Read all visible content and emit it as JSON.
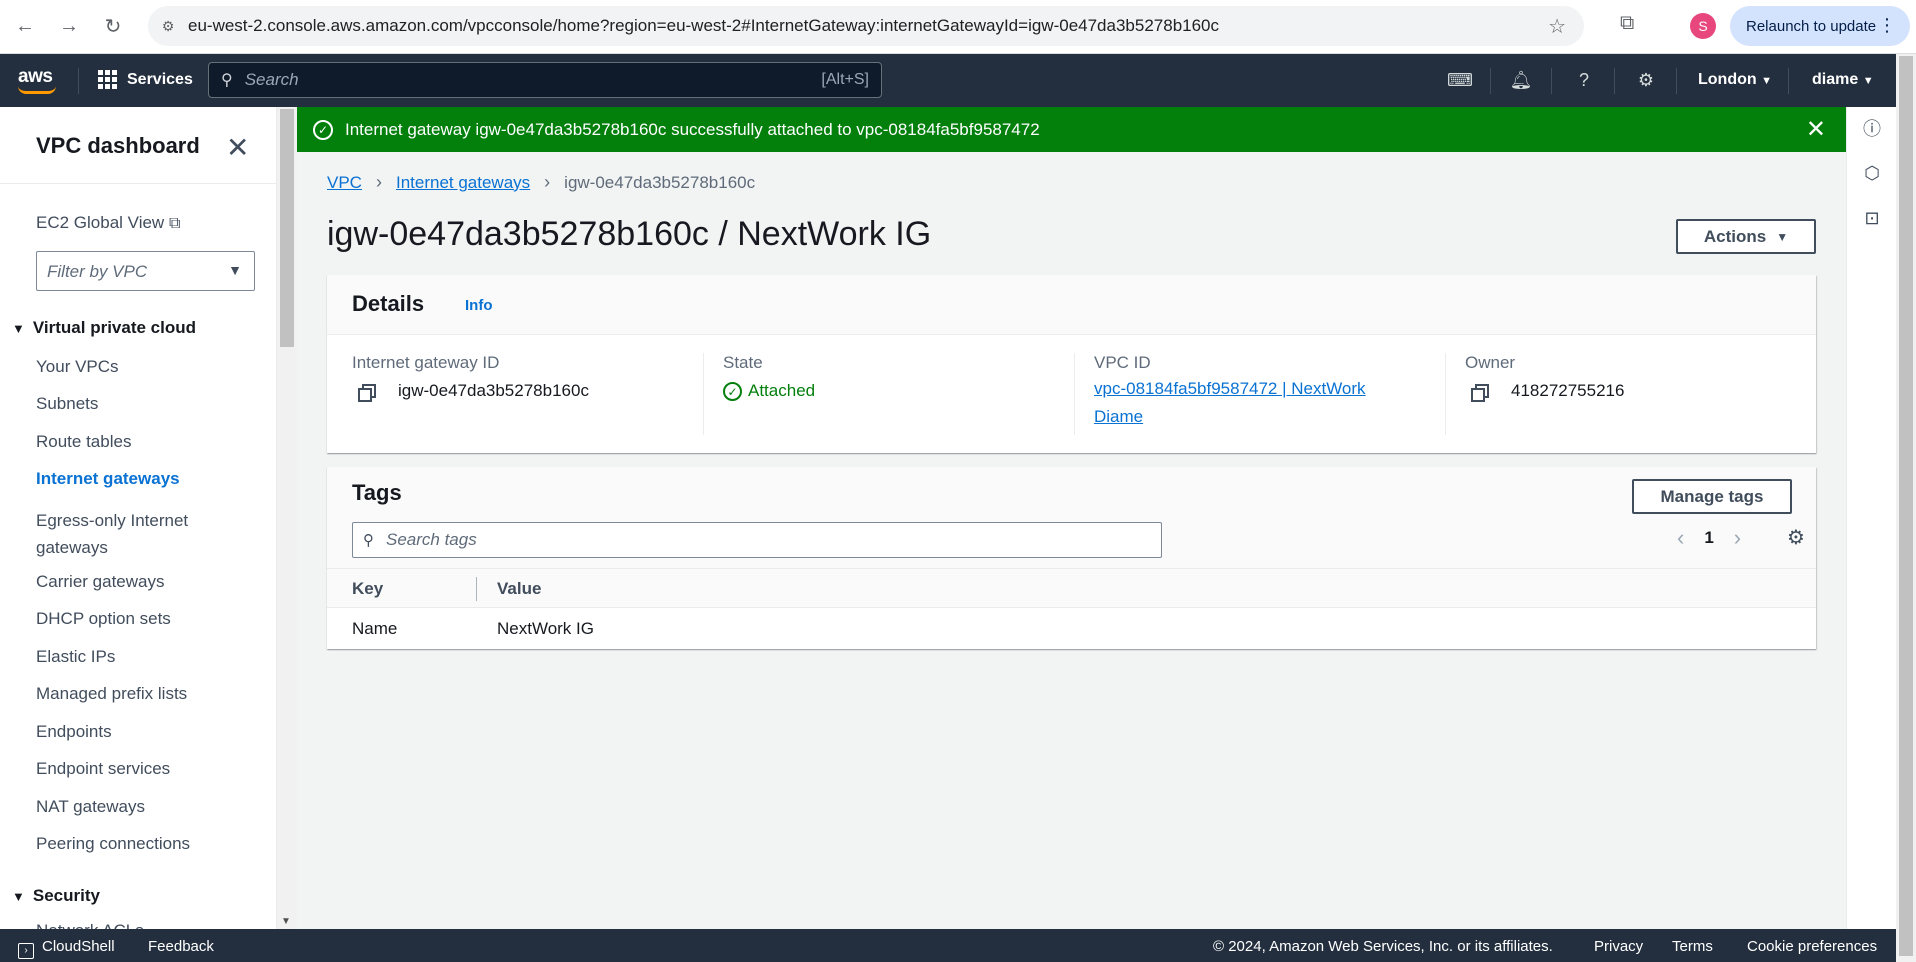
{
  "browser": {
    "url": "eu-west-2.console.aws.amazon.com/vpcconsole/home?region=eu-west-2#InternetGateway:internetGatewayId=igw-0e47da3b5278b160c",
    "profile_initial": "S",
    "relaunch_label": "Relaunch to update"
  },
  "topnav": {
    "logo": "aws",
    "services_label": "Services",
    "search_placeholder": "Search",
    "search_shortcut": "[Alt+S]",
    "region": "London",
    "account": "diame"
  },
  "sidebar": {
    "title": "VPC dashboard",
    "ec2_global_view": "EC2 Global View",
    "filter_placeholder": "Filter by VPC",
    "section_vpc": "Virtual private cloud",
    "items": [
      "Your VPCs",
      "Subnets",
      "Route tables",
      "Internet gateways",
      "Egress-only Internet gateways",
      "Carrier gateways",
      "DHCP option sets",
      "Elastic IPs",
      "Managed prefix lists",
      "Endpoints",
      "Endpoint services",
      "NAT gateways",
      "Peering connections"
    ],
    "active_item": "Internet gateways",
    "section_security": "Security",
    "partial_item": "Network ACLs"
  },
  "flash": {
    "message": "Internet gateway igw-0e47da3b5278b160c successfully attached to vpc-08184fa5bf9587472",
    "color": "#037f0c"
  },
  "breadcrumb": {
    "root": "VPC",
    "parent": "Internet gateways",
    "current": "igw-0e47da3b5278b160c"
  },
  "page": {
    "title": "igw-0e47da3b5278b160c / NextWork IG",
    "actions_label": "Actions"
  },
  "details": {
    "title": "Details",
    "info_label": "Info",
    "igw_id_label": "Internet gateway ID",
    "igw_id_value": "igw-0e47da3b5278b160c",
    "state_label": "State",
    "state_value": "Attached",
    "vpc_id_label": "VPC ID",
    "vpc_id_value": "vpc-08184fa5bf9587472 | NextWork Diame",
    "owner_label": "Owner",
    "owner_value": "418272755216"
  },
  "tags": {
    "title": "Tags",
    "manage_label": "Manage tags",
    "search_placeholder": "Search tags",
    "page_number": "1",
    "columns": [
      "Key",
      "Value"
    ],
    "rows": [
      {
        "key": "Name",
        "value": "NextWork IG"
      }
    ]
  },
  "footer": {
    "cloudshell": "CloudShell",
    "feedback": "Feedback",
    "copyright": "© 2024, Amazon Web Services, Inc. or its affiliates.",
    "privacy": "Privacy",
    "terms": "Terms",
    "cookies": "Cookie preferences"
  }
}
